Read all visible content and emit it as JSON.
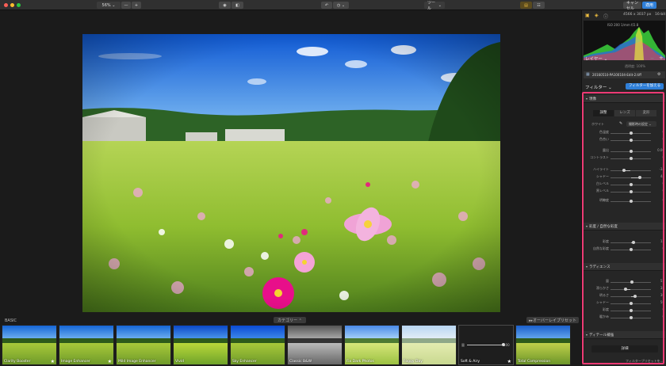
{
  "toolbar": {
    "zoom": "56%",
    "zoom_out": "—",
    "zoom_in": "+",
    "tools_label": "ツール",
    "cancel_label": "キャンセル",
    "apply_label": "適用"
  },
  "panel": {
    "image_dims": "4566 x 3037 px",
    "bit_depth": "16-bit",
    "exif": "ISO 200   1/mm   f/2.8",
    "layers_label": "レイヤー",
    "opacity_label": "透明度: 100%",
    "file_name": "20160510-PA100104-Edit-2.tiff",
    "filters_label": "フィルター",
    "add_filter_label": "フィルターを加える",
    "preset_label": "フィルタープリセットを..."
  },
  "basic": {
    "title": "現像",
    "tabs": [
      "調整",
      "レンズ",
      "変形"
    ],
    "white_label": "ホワイト",
    "white_value": "撮影時の設定",
    "sliders_a": [
      {
        "label": "色温度",
        "value": "0",
        "pos": 0.5
      },
      {
        "label": "色合い",
        "value": "0",
        "pos": 0.5
      }
    ],
    "sliders_b": [
      {
        "label": "露出",
        "value": "0.00",
        "pos": 0.5
      },
      {
        "label": "コントラスト",
        "value": "0",
        "pos": 0.5
      }
    ],
    "sliders_c": [
      {
        "label": "ハイライト",
        "value": "-34",
        "pos": 0.33
      },
      {
        "label": "シャドー",
        "value": "44",
        "pos": 0.72
      },
      {
        "label": "白レベル",
        "value": "0",
        "pos": 0.5
      },
      {
        "label": "黒レベル",
        "value": "0",
        "pos": 0.5
      }
    ],
    "sliders_d": [
      {
        "label": "明瞭度",
        "value": "0",
        "pos": 0.5
      }
    ]
  },
  "vibrance": {
    "title": "彩度 / 自然な彩度",
    "sliders": [
      {
        "label": "彩度",
        "value": "13",
        "pos": 0.56
      },
      {
        "label": "自然な彩度",
        "value": "0",
        "pos": 0.5
      }
    ]
  },
  "radiance": {
    "title": "ラディエンス",
    "sliders": [
      {
        "label": "量",
        "value": "52",
        "pos": 0.52
      },
      {
        "label": "滑らかさ",
        "value": "38",
        "pos": 0.38
      },
      {
        "label": "明るさ",
        "value": "30",
        "pos": 0.6
      },
      {
        "label": "シャドー",
        "value": "50",
        "pos": 0.5
      },
      {
        "label": "彩度",
        "value": "0",
        "pos": 0.5
      },
      {
        "label": "暖かみ",
        "value": "0",
        "pos": 0.5
      }
    ]
  },
  "detail": {
    "title": "ディテール補強",
    "detail_button": "詳細"
  },
  "filmstrip": {
    "category_label": "BASIC",
    "category_menu": "カテゴリー",
    "overlay_label": "オーバーレイプリセット",
    "amount_label": "量",
    "amount_value": "100",
    "presets": [
      {
        "name": "Clarity Booster",
        "starred": true,
        "bw": false,
        "dark": false
      },
      {
        "name": "Image Enhancer",
        "starred": true,
        "bw": false,
        "dark": false
      },
      {
        "name": "Mild Image Enhancer",
        "starred": false,
        "bw": false,
        "dark": false
      },
      {
        "name": "Vivid",
        "starred": false,
        "bw": false,
        "dark": false
      },
      {
        "name": "Sky Enhancer",
        "starred": false,
        "bw": false,
        "dark": false
      },
      {
        "name": "Classic B&W",
        "starred": false,
        "bw": true,
        "dark": false
      },
      {
        "name": "Fix Dark Photos",
        "starred": false,
        "bw": false,
        "dark": false
      },
      {
        "name": "Foggy Day",
        "starred": false,
        "bw": false,
        "dark": false
      },
      {
        "name": "Soft & Airy",
        "starred": true,
        "bw": false,
        "dark": true
      },
      {
        "name": "Total Compression",
        "starred": false,
        "bw": false,
        "dark": false
      }
    ]
  },
  "colors": {
    "accent_blue": "#2f7fd8",
    "highlight_pink": "#ec3a74"
  }
}
